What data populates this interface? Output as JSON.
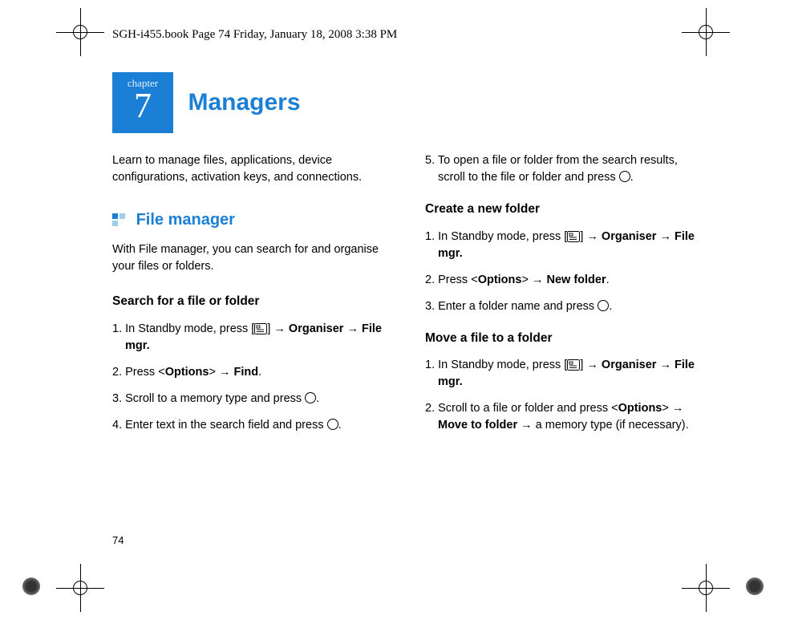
{
  "header": "SGH-i455.book  Page 74  Friday, January 18, 2008  3:38 PM",
  "chapter": {
    "label": "chapter",
    "number": "7",
    "title": "Managers"
  },
  "intro": "Learn to manage files, applications, device configurations, activation keys, and connections.",
  "section": {
    "title": "File manager",
    "desc": "With File manager, you can search for and organise your files or folders."
  },
  "search": {
    "title": "Search for a file or folder",
    "s1a": "1. In Standby mode, press [",
    "s1b": "] → ",
    "s1c": "Organiser",
    "s1d": " → ",
    "s1e": "File mgr.",
    "s2a": "2. Press <",
    "s2b": "Options",
    "s2c": "> → ",
    "s2d": "Find",
    "s2e": ".",
    "s3a": "3. Scroll to a memory type and press ",
    "s3b": ".",
    "s4a": "4. Enter text in the search field and press ",
    "s4b": "."
  },
  "col2": {
    "s5a": "5. To open a file or folder from the search results, scroll to the file or folder and press ",
    "s5b": "."
  },
  "create": {
    "title": "Create a new folder",
    "s1a": "1. In Standby mode, press [",
    "s1b": "] → ",
    "s1c": "Organiser",
    "s1d": " → ",
    "s1e": "File mgr.",
    "s2a": "2. Press <",
    "s2b": "Options",
    "s2c": "> → ",
    "s2d": "New folder",
    "s2e": ".",
    "s3a": "3. Enter a folder name and press ",
    "s3b": "."
  },
  "move": {
    "title": "Move a file to a folder",
    "s1a": "1. In Standby mode, press [",
    "s1b": "] → ",
    "s1c": "Organiser",
    "s1d": " → ",
    "s1e": "File mgr.",
    "s2a": "2. Scroll to a file or folder and press <",
    "s2b": "Options",
    "s2c": "> → ",
    "s2d": "Move to folder",
    "s2e": " → a memory type (if necessary)."
  },
  "page_number": "74"
}
